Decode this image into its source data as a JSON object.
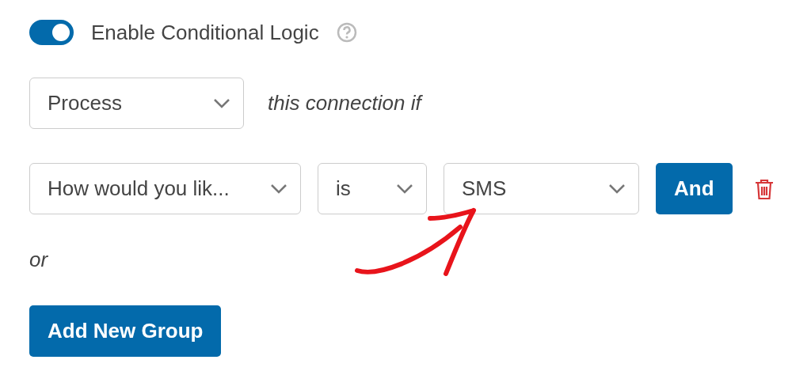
{
  "toggle": {
    "label": "Enable Conditional Logic",
    "on": true
  },
  "action": {
    "value": "Process",
    "suffix": "this connection if"
  },
  "rule": {
    "field": "How would you lik...",
    "operator": "is",
    "value": "SMS",
    "and_button": "And"
  },
  "or_label": "or",
  "add_group_button": "Add New Group"
}
